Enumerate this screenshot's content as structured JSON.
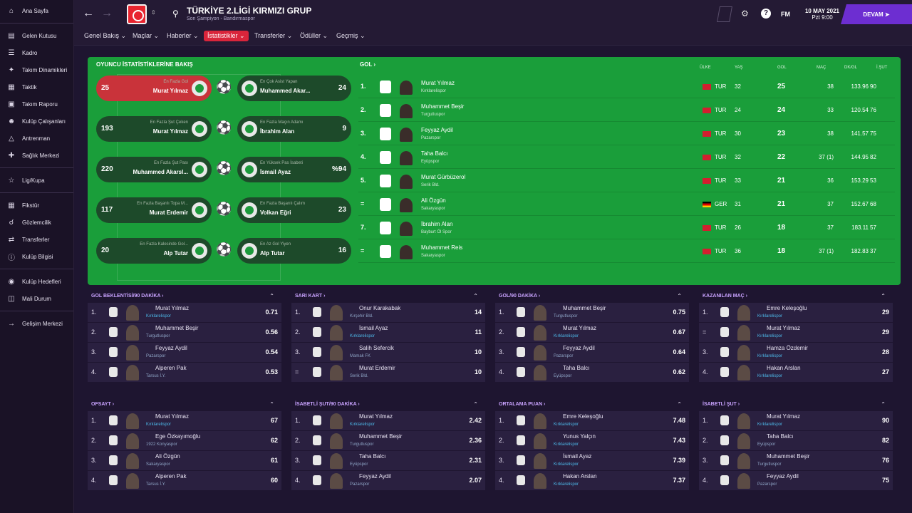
{
  "sidebar": {
    "items": [
      {
        "label": "Ana Sayfa",
        "icon": "home-icon"
      },
      {
        "label": "Gelen Kutusu",
        "icon": "inbox-icon"
      },
      {
        "label": "Kadro",
        "icon": "squad-icon"
      },
      {
        "label": "Takım Dinamikleri",
        "icon": "dynamics-icon"
      },
      {
        "label": "Taktik",
        "icon": "tactics-icon"
      },
      {
        "label": "Takım Raporu",
        "icon": "report-icon"
      },
      {
        "label": "Kulüp Çalışanları",
        "icon": "staff-icon"
      },
      {
        "label": "Antrenman",
        "icon": "training-icon"
      },
      {
        "label": "Sağlık Merkezi",
        "icon": "medical-icon"
      },
      {
        "label": "Lig/Kupa",
        "icon": "trophy-icon"
      },
      {
        "label": "Fikstür",
        "icon": "fixtures-icon"
      },
      {
        "label": "Gözlemcilik",
        "icon": "scouting-icon"
      },
      {
        "label": "Transferler",
        "icon": "transfers-icon"
      },
      {
        "label": "Kulüp Bilgisi",
        "icon": "club-info-icon"
      },
      {
        "label": "Kulüp Hedefleri",
        "icon": "club-vision-icon"
      },
      {
        "label": "Mali Durum",
        "icon": "finances-icon"
      },
      {
        "label": "Gelişim Merkezi",
        "icon": "development-icon"
      }
    ]
  },
  "header": {
    "title": "TÜRKİYE 2.LİGİ KIRMIZI GRUP",
    "subtitle": "Son Şampiyon - Bandırmaspor",
    "fm": "FM",
    "date": "10 MAY 2021",
    "day": "Pzt 9:00",
    "continue": "DEVAM"
  },
  "subnav": [
    "Genel Bakış",
    "Maçlar",
    "Haberler",
    "İstatistikler",
    "Transferler",
    "Ödüller",
    "Geçmiş"
  ],
  "overview": {
    "title": "OYUNCU İSTATİSTİKLERİNE BAKIŞ",
    "left": [
      {
        "cap": "En Fazla Gol",
        "name": "Murat Yılmaz",
        "val": "25"
      },
      {
        "cap": "En Fazla Şut Çeken",
        "name": "Murat Yılmaz",
        "val": "193"
      },
      {
        "cap": "En Fazla Şut Pası",
        "name": "Muhammed Akarsl...",
        "val": "220"
      },
      {
        "cap": "En Fazla Başarılı Topa M...",
        "name": "Murat Erdemir",
        "val": "117"
      },
      {
        "cap": "En Fazla Kalesinde Gol...",
        "name": "Alp Tutar",
        "val": "20"
      }
    ],
    "right": [
      {
        "cap": "En Çok Asist Yapan",
        "name": "Muhammed Akar...",
        "val": "24"
      },
      {
        "cap": "En Fazla Maçın Adamı",
        "name": "İbrahim Alan",
        "val": "9"
      },
      {
        "cap": "En Yüksek Pas İsabeti",
        "name": "İsmail Ayaz",
        "val": "%94"
      },
      {
        "cap": "En Fazla Başarılı Çalım",
        "name": "Volkan Eğri",
        "val": "23"
      },
      {
        "cap": "En Az Gol Yiyen",
        "name": "Alp Tutar",
        "val": "16"
      }
    ]
  },
  "goals": {
    "title": "GOL",
    "headers": [
      "ÜLKE",
      "YAŞ",
      "GOL",
      "MAÇ",
      "DK/GL",
      "İ.ŞUT"
    ],
    "rows": [
      {
        "rank": "1.",
        "name": "Murat Yılmaz",
        "club": "Kırklarelispor",
        "country": "TUR",
        "age": "32",
        "goals": "25",
        "apps": "38",
        "mpg": "133.96",
        "sot": "90"
      },
      {
        "rank": "2.",
        "name": "Muhammet Beşir",
        "club": "Turgutluspor",
        "country": "TUR",
        "age": "24",
        "goals": "24",
        "apps": "33",
        "mpg": "120.54",
        "sot": "76"
      },
      {
        "rank": "3.",
        "name": "Feyyaz Aydil",
        "club": "Pazarspor",
        "country": "TUR",
        "age": "30",
        "goals": "23",
        "apps": "38",
        "mpg": "141.57",
        "sot": "75"
      },
      {
        "rank": "4.",
        "name": "Taha Balcı",
        "club": "Eyüpspor",
        "country": "TUR",
        "age": "32",
        "goals": "22",
        "apps": "37 (1)",
        "mpg": "144.95",
        "sot": "82"
      },
      {
        "rank": "5.",
        "name": "Murat Gürbüzerol",
        "club": "Serik Bld.",
        "country": "TUR",
        "age": "33",
        "goals": "21",
        "apps": "36",
        "mpg": "153.29",
        "sot": "53"
      },
      {
        "rank": "=",
        "name": "Ali Özgün",
        "club": "Sakaryaspor",
        "country": "GER",
        "age": "31",
        "goals": "21",
        "apps": "37",
        "mpg": "152.67",
        "sot": "68"
      },
      {
        "rank": "7.",
        "name": "İbrahim Alan",
        "club": "Bayburt Öl Spor",
        "country": "TUR",
        "age": "26",
        "goals": "18",
        "apps": "37",
        "mpg": "183.11",
        "sot": "57"
      },
      {
        "rank": "=",
        "name": "Muhammet Reis",
        "club": "Sakaryaspor",
        "country": "TUR",
        "age": "36",
        "goals": "18",
        "apps": "37 (1)",
        "mpg": "182.83",
        "sot": "37"
      }
    ]
  },
  "panels": [
    {
      "title": "GOL BEKLENTİSİ/90 DAKİKA",
      "rows": [
        [
          "1.",
          "Murat Yılmaz",
          "Kırklarelispor",
          "0.71"
        ],
        [
          "2.",
          "Muhammet Beşir",
          "Turgutluspor",
          "0.56"
        ],
        [
          "3.",
          "Feyyaz Aydil",
          "Pazarspor",
          "0.54"
        ],
        [
          "4.",
          "Alperen Pak",
          "Tarsus İ.Y.",
          "0.53"
        ]
      ]
    },
    {
      "title": "SARI KART",
      "rows": [
        [
          "1.",
          "Onur Karakabak",
          "Kırşehir Bld.",
          "14"
        ],
        [
          "2.",
          "İsmail Ayaz",
          "Kırklarelispor",
          "11"
        ],
        [
          "3.",
          "Salih Sefercik",
          "Mamak FK",
          "10"
        ],
        [
          "=",
          "Murat Erdemir",
          "Serik Bld.",
          "10"
        ]
      ]
    },
    {
      "title": "GOL/90 DAKİKA",
      "rows": [
        [
          "1.",
          "Muhammet Beşir",
          "Turgutluspor",
          "0.75"
        ],
        [
          "2.",
          "Murat Yılmaz",
          "Kırklarelispor",
          "0.67"
        ],
        [
          "3.",
          "Feyyaz Aydil",
          "Pazarspor",
          "0.64"
        ],
        [
          "4.",
          "Taha Balcı",
          "Eyüpspor",
          "0.62"
        ]
      ]
    },
    {
      "title": "KAZANILAN MAÇ",
      "rows": [
        [
          "1.",
          "Emre Keleşoğlu",
          "Kırklarelispor",
          "29"
        ],
        [
          "=",
          "Murat Yılmaz",
          "Kırklarelispor",
          "29"
        ],
        [
          "3.",
          "Hamza Özdemir",
          "Kırklarelispor",
          "28"
        ],
        [
          "4.",
          "Hakan Arslan",
          "Kırklarelispor",
          "27"
        ]
      ]
    },
    {
      "title": "OFSAYT",
      "rows": [
        [
          "1.",
          "Murat Yılmaz",
          "Kırklarelispor",
          "67"
        ],
        [
          "2.",
          "Ege Özkayımoğlu",
          "1922 Konyaspor",
          "62"
        ],
        [
          "3.",
          "Ali Özgün",
          "Sakaryaspor",
          "61"
        ],
        [
          "4.",
          "Alperen Pak",
          "Tarsus İ.Y.",
          "60"
        ]
      ]
    },
    {
      "title": "İSABETLİ ŞUT/90 DAKİKA",
      "rows": [
        [
          "1.",
          "Murat Yılmaz",
          "Kırklarelispor",
          "2.42"
        ],
        [
          "2.",
          "Muhammet Beşir",
          "Turgutluspor",
          "2.36"
        ],
        [
          "3.",
          "Taha Balcı",
          "Eyüpspor",
          "2.31"
        ],
        [
          "4.",
          "Feyyaz Aydil",
          "Pazarspor",
          "2.07"
        ]
      ]
    },
    {
      "title": "ORTALAMA PUAN",
      "rows": [
        [
          "1.",
          "Emre Keleşoğlu",
          "Kırklarelispor",
          "7.48"
        ],
        [
          "2.",
          "Yunus Yalçın",
          "Kırklarelispor",
          "7.43"
        ],
        [
          "3.",
          "İsmail Ayaz",
          "Kırklarelispor",
          "7.39"
        ],
        [
          "4.",
          "Hakan Arslan",
          "Kırklarelispor",
          "7.37"
        ]
      ]
    },
    {
      "title": "İSABETLİ ŞUT",
      "rows": [
        [
          "1.",
          "Murat Yılmaz",
          "Kırklarelispor",
          "90"
        ],
        [
          "2.",
          "Taha Balcı",
          "Eyüpspor",
          "82"
        ],
        [
          "3.",
          "Muhammet Beşir",
          "Turgutluspor",
          "76"
        ],
        [
          "4.",
          "Feyyaz Aydil",
          "Pazarspor",
          "75"
        ]
      ]
    }
  ]
}
